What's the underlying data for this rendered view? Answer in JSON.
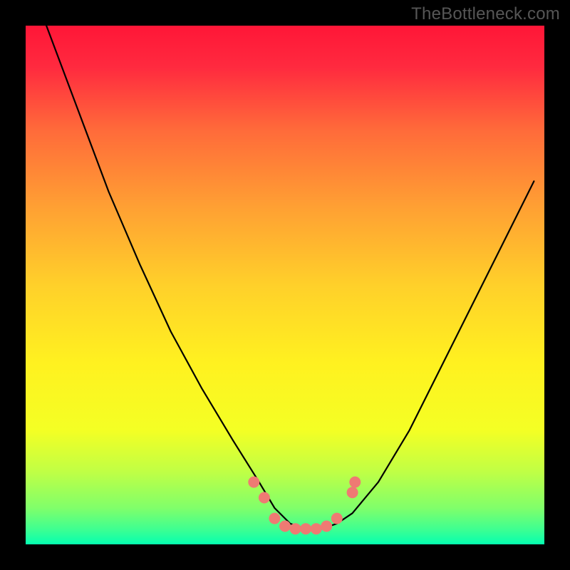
{
  "watermark": "TheBottleneck.com",
  "chart_data": {
    "type": "line",
    "title": "",
    "xlabel": "",
    "ylabel": "",
    "xlim": [
      0,
      100
    ],
    "ylim": [
      0,
      100
    ],
    "axes_visible": false,
    "grid": false,
    "background_gradient": {
      "stops": [
        {
          "pos": 0.0,
          "color": "#ff1637"
        },
        {
          "pos": 0.08,
          "color": "#ff2a3f"
        },
        {
          "pos": 0.2,
          "color": "#ff6a3a"
        },
        {
          "pos": 0.35,
          "color": "#ffa033"
        },
        {
          "pos": 0.5,
          "color": "#ffd02a"
        },
        {
          "pos": 0.65,
          "color": "#fff120"
        },
        {
          "pos": 0.78,
          "color": "#f4ff24"
        },
        {
          "pos": 0.86,
          "color": "#c0ff45"
        },
        {
          "pos": 0.93,
          "color": "#80ff6a"
        },
        {
          "pos": 0.97,
          "color": "#40ff90"
        },
        {
          "pos": 1.0,
          "color": "#05ffb0"
        }
      ]
    },
    "series": [
      {
        "name": "bottleneck-curve",
        "color": "#000000",
        "x": [
          4,
          10,
          16,
          22,
          28,
          34,
          40,
          45,
          48,
          51,
          54,
          57,
          60,
          63,
          68,
          74,
          80,
          86,
          92,
          98
        ],
        "values": [
          100,
          84,
          68,
          54,
          41,
          30,
          20,
          12,
          7,
          4,
          3,
          3,
          4,
          6,
          12,
          22,
          34,
          46,
          58,
          70
        ]
      }
    ],
    "markers": {
      "name": "highlight-dots",
      "color": "#ef7a73",
      "points": [
        {
          "x": 44,
          "y": 12
        },
        {
          "x": 46,
          "y": 9
        },
        {
          "x": 48,
          "y": 5
        },
        {
          "x": 50,
          "y": 3.5
        },
        {
          "x": 52,
          "y": 3
        },
        {
          "x": 54,
          "y": 3
        },
        {
          "x": 56,
          "y": 3
        },
        {
          "x": 58,
          "y": 3.5
        },
        {
          "x": 60,
          "y": 5
        },
        {
          "x": 63,
          "y": 10
        },
        {
          "x": 63.5,
          "y": 12
        }
      ]
    },
    "frame": {
      "color": "#000000",
      "thickness_px": 36
    }
  }
}
